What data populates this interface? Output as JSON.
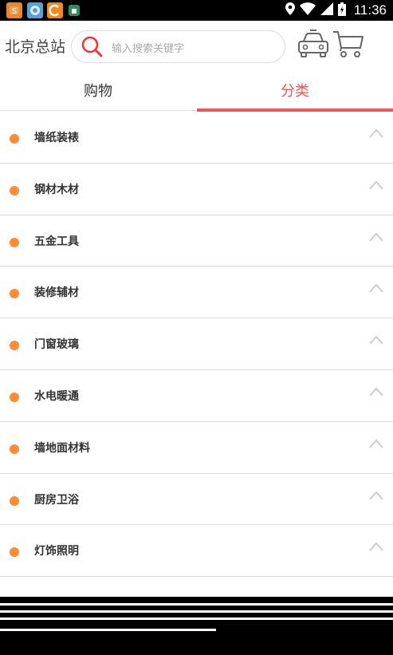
{
  "status_bar": {
    "time": "11:36",
    "app_icons": [
      "weibo-app-icon",
      "gallery-app-icon",
      "browser-app-icon",
      "store-app-icon"
    ]
  },
  "header": {
    "city": "北京总站",
    "search_placeholder": "输入搜索关键字",
    "search_icon_color": "#e83a3a"
  },
  "tabs": [
    {
      "label": "购物",
      "active": false
    },
    {
      "label": "分类",
      "active": true,
      "color": "#f05555"
    }
  ],
  "categories": [
    {
      "label": "墙纸装裱"
    },
    {
      "label": "钢材木材"
    },
    {
      "label": "五金工具"
    },
    {
      "label": "装修辅材"
    },
    {
      "label": "门窗玻璃"
    },
    {
      "label": "水电暖通"
    },
    {
      "label": "墙地面材料"
    },
    {
      "label": "厨房卫浴"
    },
    {
      "label": "灯饰照明"
    }
  ],
  "colors": {
    "accent": "#f05555",
    "bullet": "#ff8b36"
  }
}
